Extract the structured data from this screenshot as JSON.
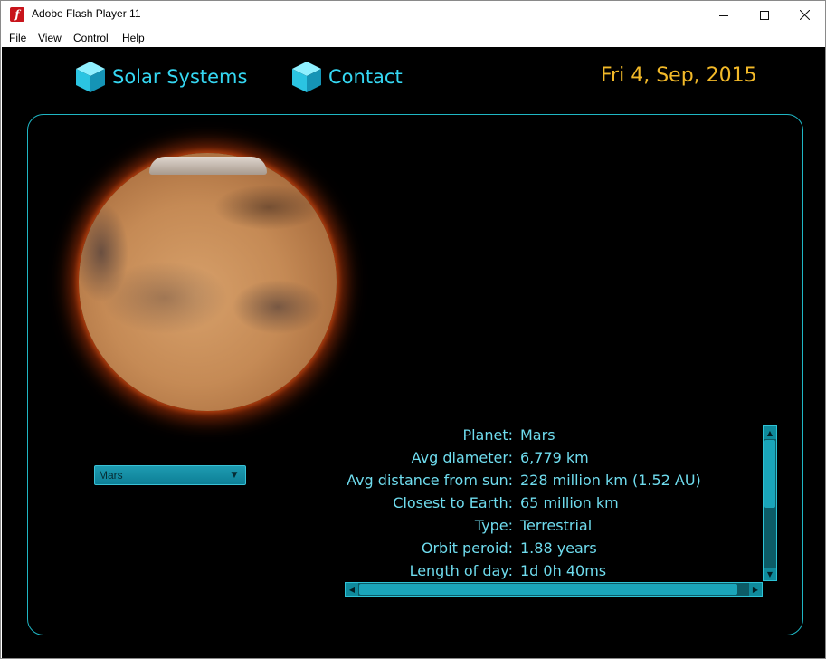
{
  "window": {
    "title": "Adobe Flash Player 11",
    "icon": "flash-icon",
    "controls": [
      "minimize-icon",
      "maximize-icon",
      "close-icon"
    ]
  },
  "menu": [
    "File",
    "View",
    "Control",
    "Help"
  ],
  "nav": {
    "items": [
      {
        "label": "Solar Systems",
        "icon": "cube-icon"
      },
      {
        "label": "Contact",
        "icon": "cube-icon"
      }
    ],
    "date": "Fri 4, Sep, 2015"
  },
  "planet_selector": {
    "selected": "Mars"
  },
  "planet_info": [
    {
      "label": "Planet:",
      "value": "Mars"
    },
    {
      "label": "Avg diameter:",
      "value": "6,779 km"
    },
    {
      "label": "Avg distance from sun:",
      "value": "228 million km (1.52 AU)"
    },
    {
      "label": "Closest to Earth:",
      "value": "65 million km"
    },
    {
      "label": "Type:",
      "value": "Terrestrial"
    },
    {
      "label": "Orbit peroid:",
      "value": "1.88 years"
    },
    {
      "label": "Length of day:",
      "value": "1d 0h 40ms"
    }
  ],
  "colors": {
    "accent": "#35d7f2",
    "date": "#f2b929",
    "panel_border": "#1fb6c4",
    "info_text": "#6fdcee",
    "stage_bg": "#000000"
  }
}
